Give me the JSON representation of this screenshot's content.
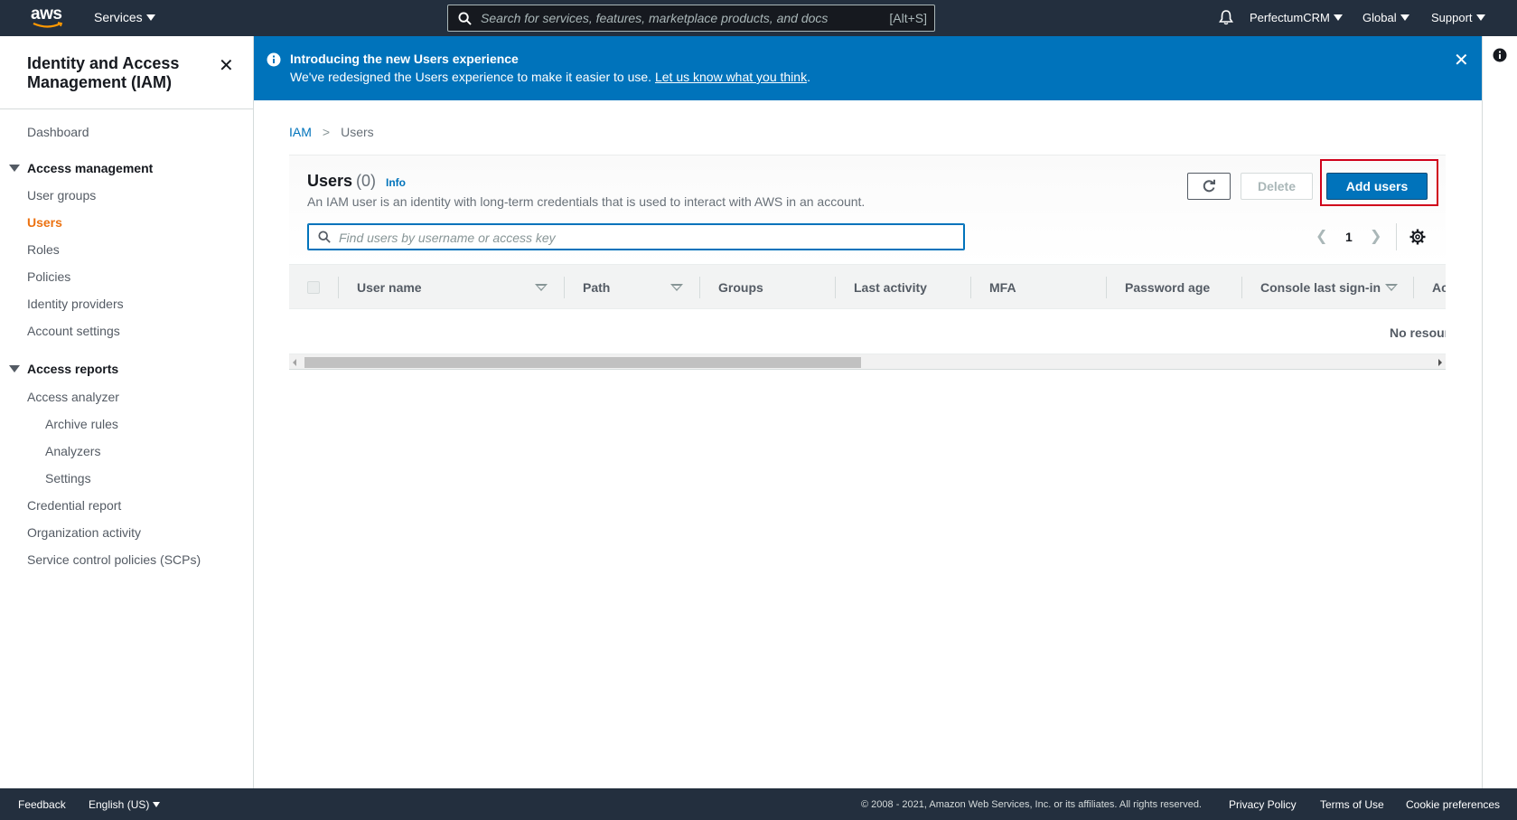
{
  "topnav": {
    "logo": "aws",
    "services": "Services",
    "search_placeholder": "Search for services, features, marketplace products, and docs",
    "search_shortcut": "[Alt+S]",
    "account": "PerfectumCRM",
    "region": "Global",
    "support": "Support"
  },
  "sidebar": {
    "title": "Identity and Access Management (IAM)",
    "close": "✕",
    "dashboard": "Dashboard",
    "access_management": {
      "label": "Access management",
      "items": [
        "User groups",
        "Users",
        "Roles",
        "Policies",
        "Identity providers",
        "Account settings"
      ]
    },
    "access_reports": {
      "label": "Access reports",
      "analyzer": "Access analyzer",
      "analyzer_items": [
        "Archive rules",
        "Analyzers",
        "Settings"
      ],
      "items": [
        "Credential report",
        "Organization activity",
        "Service control policies (SCPs)"
      ]
    }
  },
  "banner": {
    "title": "Introducing the new Users experience",
    "message": "We've redesigned the Users experience to make it easier to use.",
    "link": "Let us know what you think",
    "close": "✕"
  },
  "breadcrumb": {
    "root": "IAM",
    "current": "Users"
  },
  "users": {
    "title": "Users",
    "count": "(0)",
    "info": "Info",
    "description": "An IAM user is an identity with long-term credentials that is used to interact with AWS in an account.",
    "delete": "Delete",
    "add": "Add users",
    "filter_placeholder": "Find users by username or access key",
    "page": "1"
  },
  "table": {
    "columns": [
      "User name",
      "Path",
      "Groups",
      "Last activity",
      "MFA",
      "Password age",
      "Console last sign-in",
      "Ac"
    ],
    "empty": "No resources"
  },
  "footer": {
    "feedback": "Feedback",
    "language": "English (US)",
    "copyright": "© 2008 - 2021, Amazon Web Services, Inc. or its affiliates. All rights reserved.",
    "privacy": "Privacy Policy",
    "terms": "Terms of Use",
    "cookies": "Cookie preferences"
  },
  "colors": {
    "nav_bg": "#232f3e",
    "banner_bg": "#0073bb",
    "primary_button": "#0073bb",
    "active_nav": "#ec7211",
    "highlight": "#d0021b"
  },
  "icons": [
    "search-icon",
    "bell-icon",
    "info-icon",
    "refresh-icon",
    "gear-icon",
    "close-icon",
    "chevron-left-icon",
    "chevron-right-icon"
  ]
}
